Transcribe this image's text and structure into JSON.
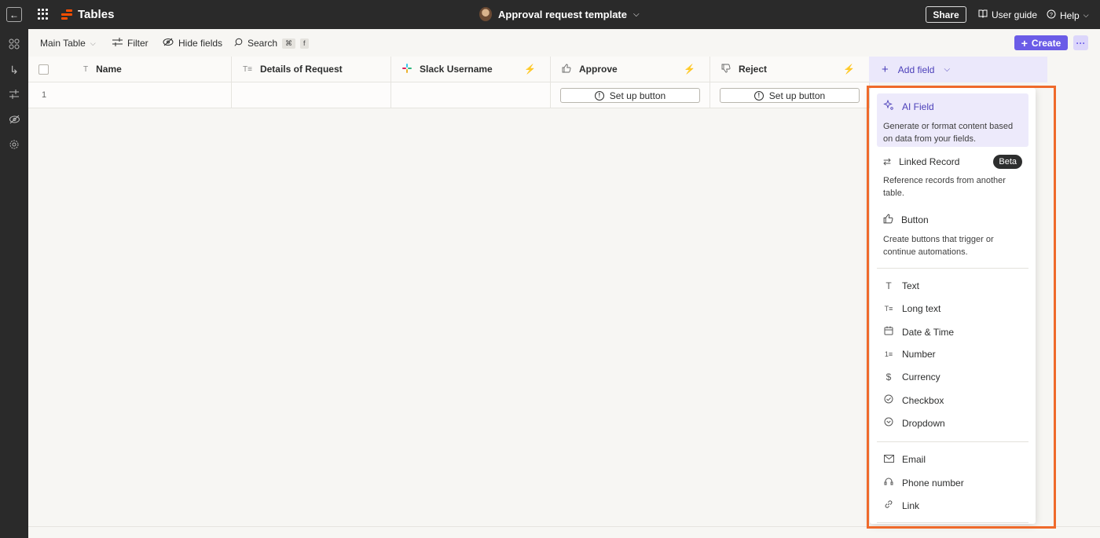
{
  "topbar": {
    "back_icon": "arrow-left-icon",
    "app_title": "Tables",
    "doc_title": "Approval request template",
    "share_label": "Share",
    "user_guide_label": "User guide",
    "help_label": "Help",
    "brand_color": "#ff4f00"
  },
  "left_rail": {
    "icons": [
      "grid-icon",
      "route-icon",
      "filter-sliders-icon",
      "hidden-eye-icon",
      "settings-gear-icon"
    ]
  },
  "toolbar": {
    "table_select_label": "Main Table",
    "filter_label": "Filter",
    "hide_fields_label": "Hide fields",
    "search_label": "Search",
    "search_shortcut_mod": "⌘",
    "search_shortcut_key": "f",
    "create_label": "Create",
    "more_label": "···",
    "accent_color": "#6b5ce7"
  },
  "table": {
    "columns": [
      {
        "name": "Name",
        "icon": "T"
      },
      {
        "name": "Details of Request",
        "icon": "T≡"
      },
      {
        "name": "Slack Username",
        "icon": "slack"
      },
      {
        "name": "Approve",
        "icon": "thumbs-up"
      },
      {
        "name": "Reject",
        "icon": "thumbs-down"
      }
    ],
    "add_field_label": "Add field",
    "rows": [
      {
        "index": "1",
        "approve_button": "Set up button",
        "reject_button": "Set up button"
      }
    ]
  },
  "dropdown": {
    "featured": [
      {
        "title": "AI Field",
        "desc": "Generate or format content based on data from your fields.",
        "icon": "ai-sparkle-icon"
      },
      {
        "title": "Linked Record",
        "desc": "Reference records from another table.",
        "icon": "link-arrows-icon",
        "badge": "Beta"
      },
      {
        "title": "Button",
        "desc": "Create buttons that trigger or continue automations.",
        "icon": "thumbs-up-icon"
      }
    ],
    "basic_items": [
      "Text",
      "Long text",
      "Date & Time",
      "Number",
      "Currency",
      "Checkbox",
      "Dropdown"
    ],
    "contact_items": [
      "Email",
      "Phone number",
      "Link"
    ],
    "highlight_color": "#ef6a2b"
  }
}
